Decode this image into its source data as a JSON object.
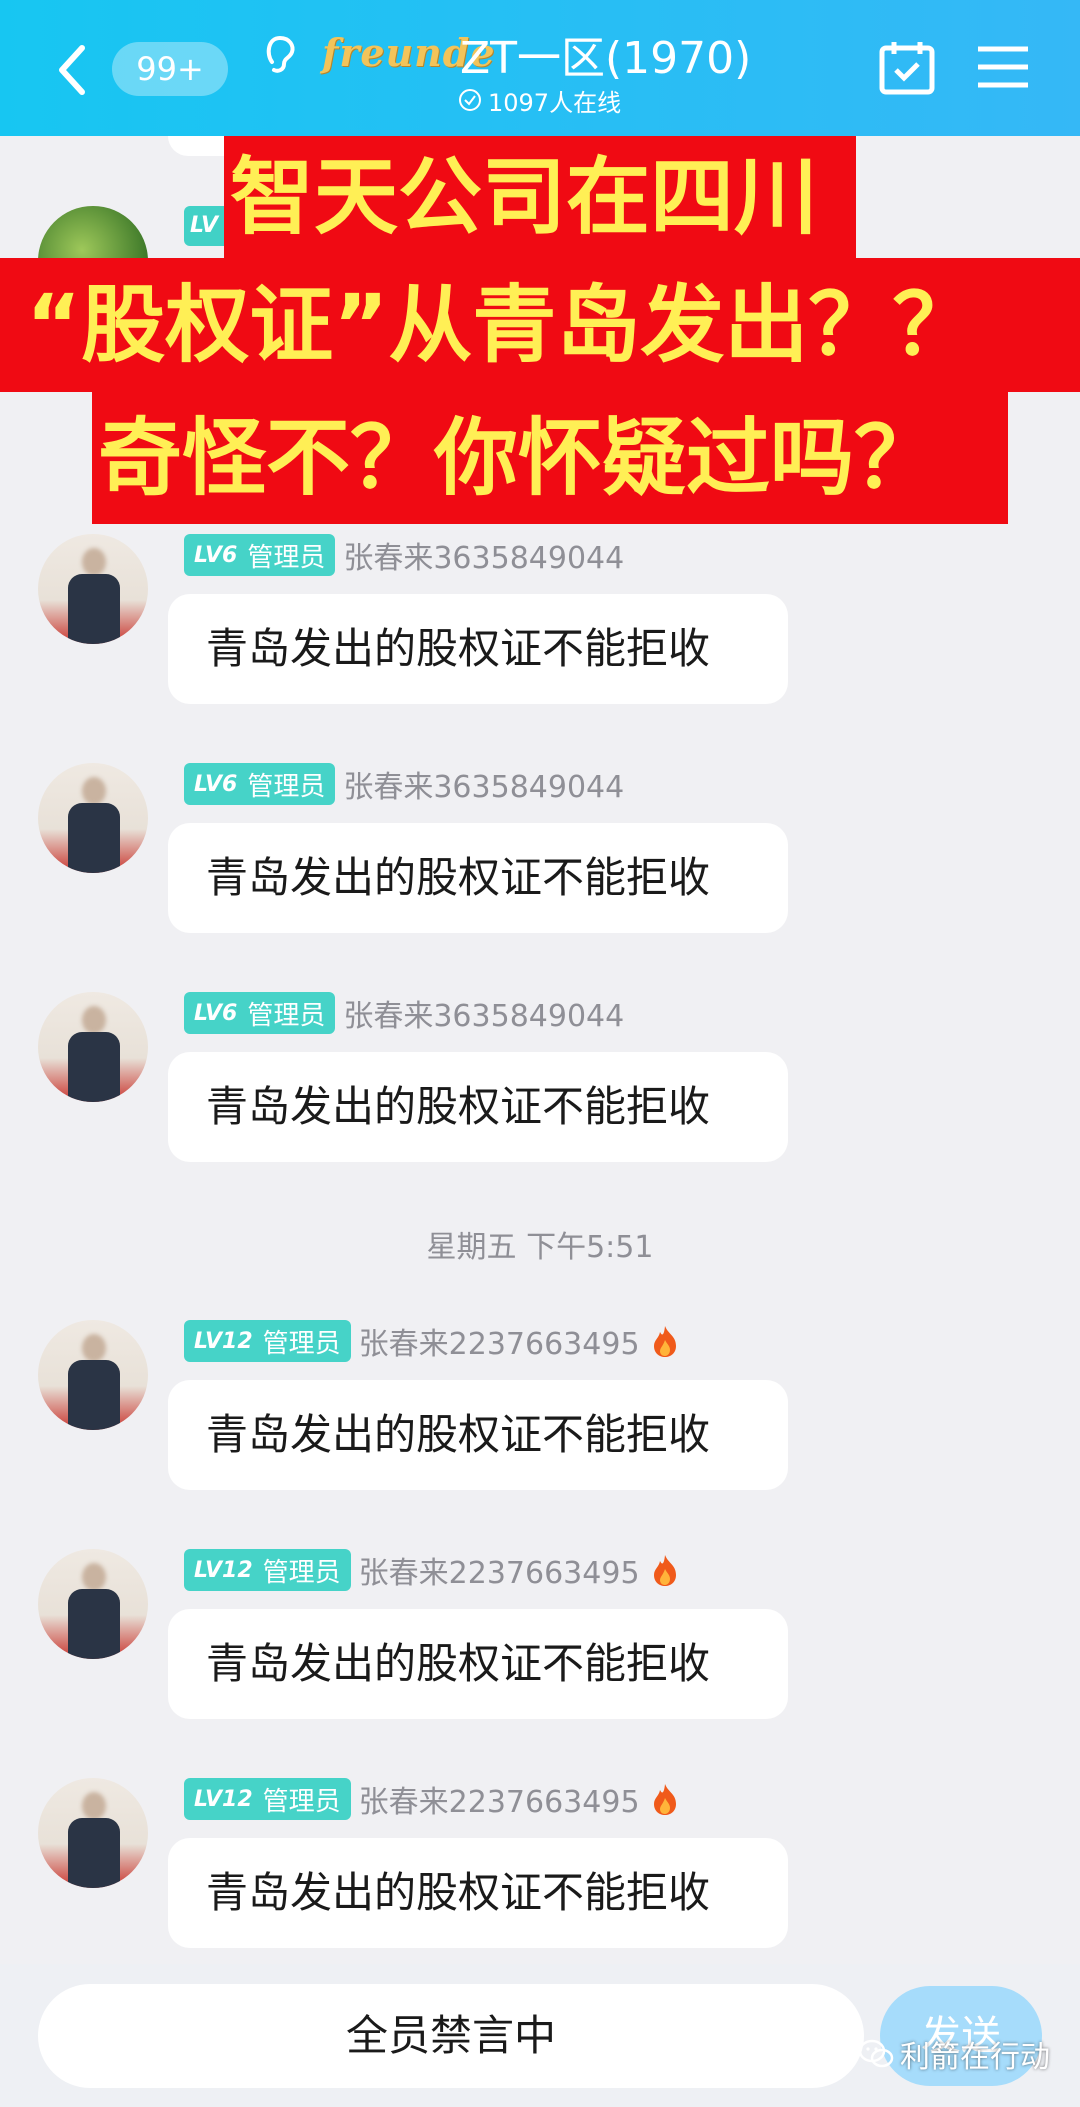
{
  "header": {
    "unread_count": "99+",
    "logo_text": "freunde",
    "group_title": "ZT一区(1970)",
    "online_text": "1097人在线"
  },
  "overlay": {
    "line1": "智天公司在四川",
    "line2": "“股权证”从青岛发出？？",
    "line3": "奇怪不？你怀疑过吗？"
  },
  "partial_message": {
    "level": "LV"
  },
  "messages": [
    {
      "level": "LV6",
      "role": "管理员",
      "username": "张春来3635849044",
      "text": "青岛发出的股权证不能拒收",
      "fire": false
    },
    {
      "level": "LV6",
      "role": "管理员",
      "username": "张春来3635849044",
      "text": "青岛发出的股权证不能拒收",
      "fire": false
    },
    {
      "level": "LV6",
      "role": "管理员",
      "username": "张春来3635849044",
      "text": "青岛发出的股权证不能拒收",
      "fire": false
    },
    {
      "level": "LV12",
      "role": "管理员",
      "username": "张春来2237663495",
      "text": "青岛发出的股权证不能拒收",
      "fire": true
    },
    {
      "level": "LV12",
      "role": "管理员",
      "username": "张春来2237663495",
      "text": "青岛发出的股权证不能拒收",
      "fire": true
    },
    {
      "level": "LV12",
      "role": "管理员",
      "username": "张春来2237663495",
      "text": "青岛发出的股权证不能拒收",
      "fire": true
    }
  ],
  "timestamp": "星期五  下午5:51",
  "bottom": {
    "input_text": "全员禁言中",
    "send_label": "发送"
  },
  "watermark": "利箭在行动",
  "colors": {
    "header": "#17c6f2",
    "banner_bg": "#f00a13",
    "banner_text": "#ffef55",
    "badge": "#46d3c8"
  }
}
